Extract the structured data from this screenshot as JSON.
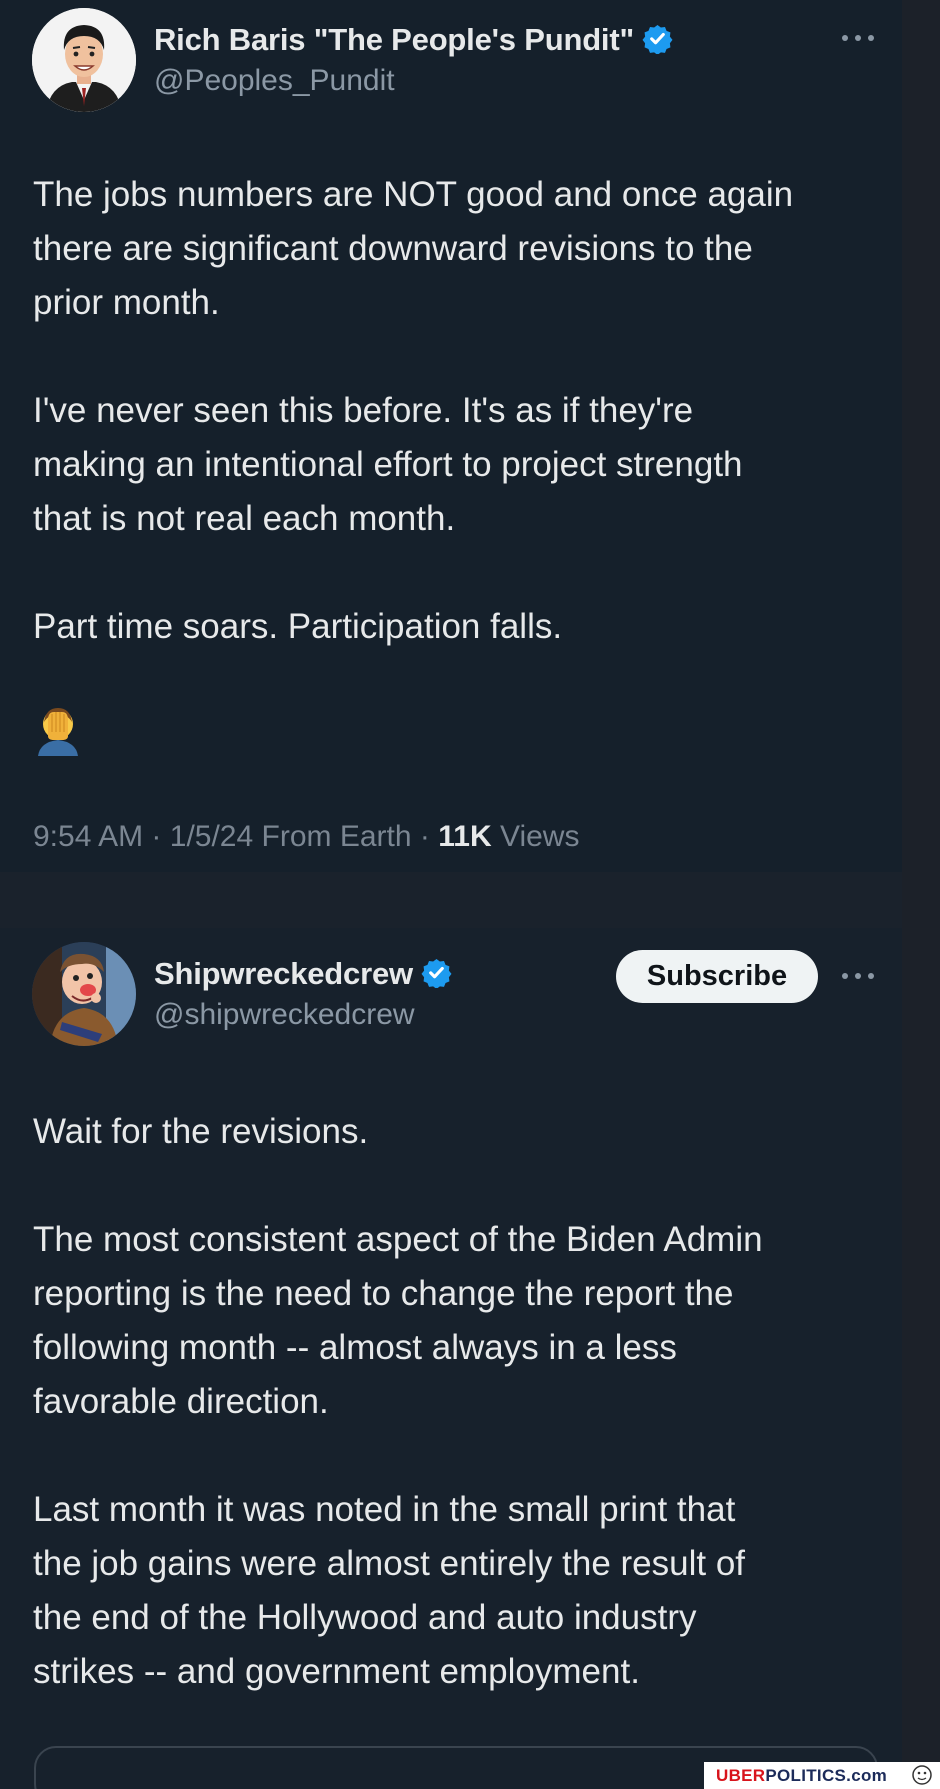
{
  "tweet_main": {
    "author": {
      "display_name": "Rich Baris \"The People's Pundit\"",
      "handle": "@Peoples_Pundit",
      "verified": true,
      "avatar_icon": "cartoon-portrait-man-avatar"
    },
    "paragraphs": [
      "The jobs numbers are NOT good and once again\nthere are significant downward revisions to the\nprior month.",
      "I've never seen this before. It's as if they're\nmaking an intentional effort to project strength\nthat is not real each month.",
      "Part time soars. Participation falls."
    ],
    "emoji_icon": "face-palm-emoji",
    "meta": {
      "time": "9:54 AM",
      "date": "1/5/24",
      "separator": "·",
      "location": "From Earth",
      "views_count": "11K",
      "views_label": "Views"
    }
  },
  "tweet_reply": {
    "author": {
      "display_name": "Shipwreckedcrew",
      "handle": "@shipwreckedcrew",
      "verified": true,
      "avatar_icon": "cartoon-character-avatar"
    },
    "subscribe_label": "Subscribe",
    "paragraphs": [
      "Wait for the revisions.",
      "The most consistent aspect of the Biden Admin\nreporting is the need to change the report the\nfollowing month -- almost always in a less\nfavorable direction.",
      "Last month it was noted in the small print that\nthe job gains were almost entirely the result of\nthe end of the Hollywood and auto industry\nstrikes -- and government employment."
    ]
  },
  "watermark": {
    "part_red": "UBER",
    "part_blue": "POLITICS.com"
  },
  "colors": {
    "background": "#15202b",
    "text": "#e7e9ea",
    "secondary_text": "#8b98a5",
    "verified_badge": "#1d9bf0",
    "subscribe_bg": "#eff3f4"
  }
}
